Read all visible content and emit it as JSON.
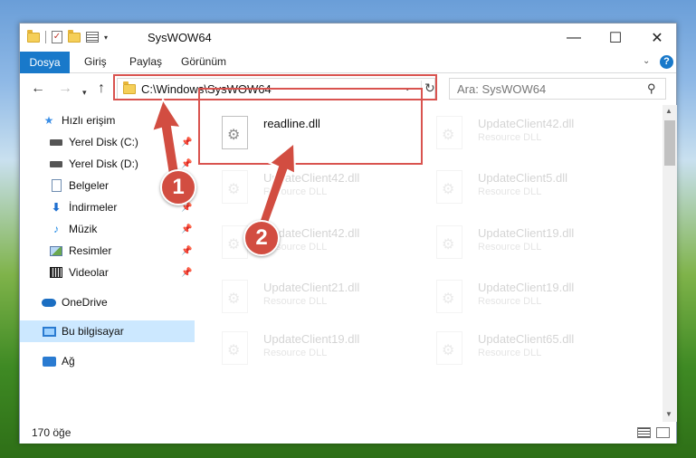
{
  "window": {
    "title": "SysWOW64",
    "controls": {
      "minimize": "—",
      "maximize": "☐",
      "close": "✕"
    }
  },
  "ribbon": {
    "tabs": [
      "Dosya",
      "Giriş",
      "Paylaş",
      "Görünüm"
    ],
    "help": "?"
  },
  "nav": {
    "address": "C:\\Windows\\SysWOW64",
    "search_placeholder": "Ara: SysWOW64"
  },
  "sidebar": {
    "items": [
      {
        "label": "Hızlı erişim",
        "icon": "star-icon"
      },
      {
        "label": "Yerel Disk (C:)",
        "icon": "drive-icon",
        "pinned": true
      },
      {
        "label": "Yerel Disk (D:)",
        "icon": "drive-icon",
        "pinned": true
      },
      {
        "label": "Belgeler",
        "icon": "document-icon",
        "pinned": true
      },
      {
        "label": "İndirmeler",
        "icon": "download-icon",
        "pinned": true
      },
      {
        "label": "Müzik",
        "icon": "music-icon",
        "pinned": true
      },
      {
        "label": "Resimler",
        "icon": "pictures-icon",
        "pinned": true
      },
      {
        "label": "Videolar",
        "icon": "video-icon",
        "pinned": true
      },
      {
        "label": "OneDrive",
        "icon": "cloud-icon"
      },
      {
        "label": "Bu bilgisayar",
        "icon": "computer-icon",
        "selected": true
      },
      {
        "label": "Ağ",
        "icon": "network-icon"
      }
    ]
  },
  "files": {
    "col1": [
      {
        "name": "readline.dll",
        "type": ""
      },
      {
        "name": "UpdateClient42.dll",
        "type": "Resource DLL"
      },
      {
        "name": "UpdateClient42.dll",
        "type": "Resource DLL"
      },
      {
        "name": "UpdateClient21.dll",
        "type": "Resource DLL"
      },
      {
        "name": "UpdateClient19.dll",
        "type": "Resource DLL"
      }
    ],
    "col2": [
      {
        "name": "UpdateClient42.dll",
        "type": "Resource DLL"
      },
      {
        "name": "UpdateClient5.dll",
        "type": "Resource DLL"
      },
      {
        "name": "UpdateClient19.dll",
        "type": "Resource DLL"
      },
      {
        "name": "UpdateClient19.dll",
        "type": "Resource DLL"
      },
      {
        "name": "UpdateClient65.dll",
        "type": "Resource DLL"
      }
    ]
  },
  "status": {
    "count": "170 öğe"
  },
  "annotations": {
    "step1": "1",
    "step2": "2"
  },
  "colors": {
    "accent": "#1979ca",
    "highlight": "#d9534f",
    "selected": "#cce8ff"
  }
}
